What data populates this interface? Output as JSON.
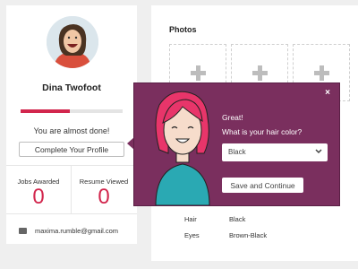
{
  "profile": {
    "name": "Dina Twofoot",
    "progress_percent": 48,
    "status_text": "You are almost done!",
    "complete_button": "Complete Your Profile",
    "stats": [
      {
        "label": "Jobs Awarded",
        "value": "0"
      },
      {
        "label": "Resume Viewed",
        "value": "0"
      }
    ],
    "email": "maxima.rumble@gmail.com"
  },
  "photos": {
    "title": "Photos",
    "slots": [
      "plus-icon",
      "plus-icon",
      "plus-icon"
    ]
  },
  "details": [
    {
      "label": "Hair",
      "value": "Black"
    },
    {
      "label": "Eyes",
      "value": "Brown-Black"
    }
  ],
  "popover": {
    "greeting": "Great!",
    "question": "What is your hair color?",
    "select_value": "Black",
    "save_button": "Save and Continue",
    "close_icon": "×",
    "colors": {
      "background": "#7a2f5e",
      "accent": "#d2264d"
    }
  }
}
